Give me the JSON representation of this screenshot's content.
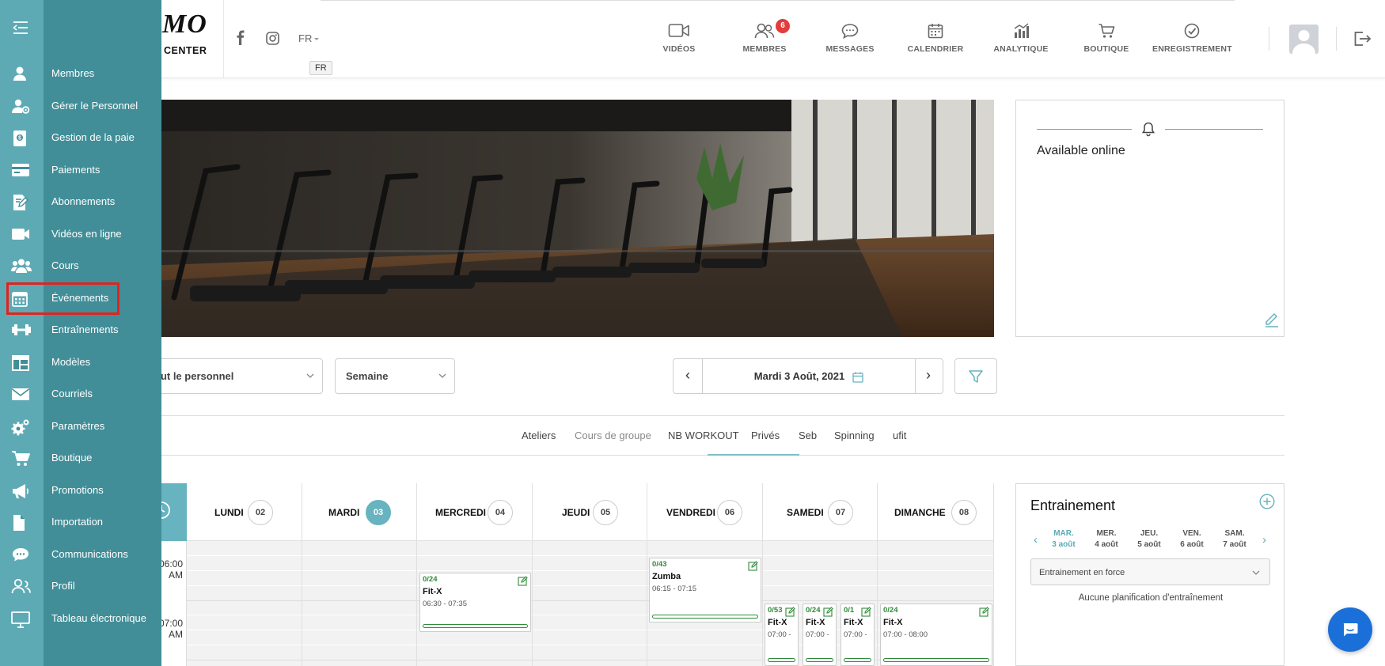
{
  "brand": {
    "logo_text": "MO",
    "logo_sub": "CENTER"
  },
  "header": {
    "language": "FR",
    "language_tooltip": "FR",
    "nav": [
      {
        "label": "VIDÉOS",
        "icon": "video-icon"
      },
      {
        "label": "MEMBRES",
        "icon": "members-icon",
        "badge": "6"
      },
      {
        "label": "MESSAGES",
        "icon": "chat-icon"
      },
      {
        "label": "CALENDRIER",
        "icon": "calendar-icon"
      },
      {
        "label": "ANALYTIQUE",
        "icon": "analytics-icon"
      },
      {
        "label": "BOUTIQUE",
        "icon": "cart-icon"
      },
      {
        "label": "ENREGISTREMENT",
        "icon": "check-circle-icon"
      }
    ]
  },
  "sidebar": {
    "items": [
      {
        "label": "Membres",
        "icon": "user-icon"
      },
      {
        "label": "Gérer le Personnel",
        "icon": "staff-icon"
      },
      {
        "label": "Gestion de la paie",
        "icon": "payroll-icon"
      },
      {
        "label": "Paiements",
        "icon": "credit-card-icon"
      },
      {
        "label": "Abonnements",
        "icon": "subscription-icon"
      },
      {
        "label": "Vidéos en ligne",
        "icon": "video-icon"
      },
      {
        "label": "Cours",
        "icon": "group-icon"
      },
      {
        "label": "Événements",
        "icon": "calendar-icon",
        "highlighted": true
      },
      {
        "label": "Entraînements",
        "icon": "dumbbell-icon"
      },
      {
        "label": "Modèles",
        "icon": "template-icon"
      },
      {
        "label": "Courriels",
        "icon": "envelope-icon"
      },
      {
        "label": "Paramètres",
        "icon": "settings-icon"
      },
      {
        "label": "Boutique",
        "icon": "cart-icon"
      },
      {
        "label": "Promotions",
        "icon": "megaphone-icon"
      },
      {
        "label": "Importation",
        "icon": "file-icon"
      },
      {
        "label": "Communications",
        "icon": "comment-icon"
      },
      {
        "label": "Profil",
        "icon": "profile-icon"
      },
      {
        "label": "Tableau électronique",
        "icon": "monitor-icon"
      }
    ]
  },
  "online_panel": {
    "title": "Available online"
  },
  "controls": {
    "staff_select": "Tout le personnel",
    "staff_select_visible": "out le personnel",
    "view_select": "Semaine",
    "date": "Mardi 3 Août, 2021",
    "prev": "‹",
    "next": "›"
  },
  "tabs": [
    "Ateliers",
    "Cours de groupe",
    "NB WORKOUT",
    "Privés",
    "Seb",
    "Spinning",
    "ufit"
  ],
  "active_tab": "Cours de groupe",
  "calendar": {
    "days": [
      {
        "name": "LUNDI",
        "num": "02"
      },
      {
        "name": "MARDI",
        "num": "03",
        "current": true
      },
      {
        "name": "MERCREDI",
        "num": "04"
      },
      {
        "name": "JEUDI",
        "num": "05"
      },
      {
        "name": "VENDREDI",
        "num": "06"
      },
      {
        "name": "SAMEDI",
        "num": "07"
      },
      {
        "name": "DIMANCHE",
        "num": "08"
      }
    ],
    "times": [
      "06:00 AM",
      "07:00 AM"
    ],
    "times_visible": [
      "06:00",
      "AM",
      "07:00",
      "AM"
    ],
    "events": [
      {
        "day": "MERCREDI",
        "count": "0/24",
        "name": "Fit-X",
        "time": "06:30 - 07:35"
      },
      {
        "day": "VENDREDI",
        "count": "0/43",
        "name": "Zumba",
        "time": "06:15 - 07:15"
      },
      {
        "day": "SAMEDI",
        "count": "0/53",
        "name": "Fit-X",
        "time": "07:00 -"
      },
      {
        "day": "SAMEDI",
        "count": "0/24",
        "name": "Fit-X",
        "time": "07:00 -"
      },
      {
        "day": "SAMEDI",
        "count": "0/1",
        "name": "Fit-X",
        "time": "07:00 -"
      },
      {
        "day": "DIMANCHE",
        "count": "0/24",
        "name": "Fit-X",
        "time": "07:00 - 08:00"
      }
    ]
  },
  "training": {
    "title": "Entrainement",
    "days": [
      {
        "day": "MAR.",
        "date": "3 août",
        "current": true
      },
      {
        "day": "MER.",
        "date": "4 août"
      },
      {
        "day": "JEU.",
        "date": "5 août"
      },
      {
        "day": "VEN.",
        "date": "6 août"
      },
      {
        "day": "SAM.",
        "date": "7 août"
      }
    ],
    "select": "Entrainement en force",
    "empty": "Aucune planification d'entraînement"
  },
  "colors": {
    "sidebar_rail": "#5daab5",
    "sidebar_panel": "#418e98",
    "accent": "#67b3bf",
    "highlight": "#e0231f",
    "badge": "#e23c3c",
    "event_green": "#2e8a3a",
    "chat": "#1a6fd8"
  }
}
